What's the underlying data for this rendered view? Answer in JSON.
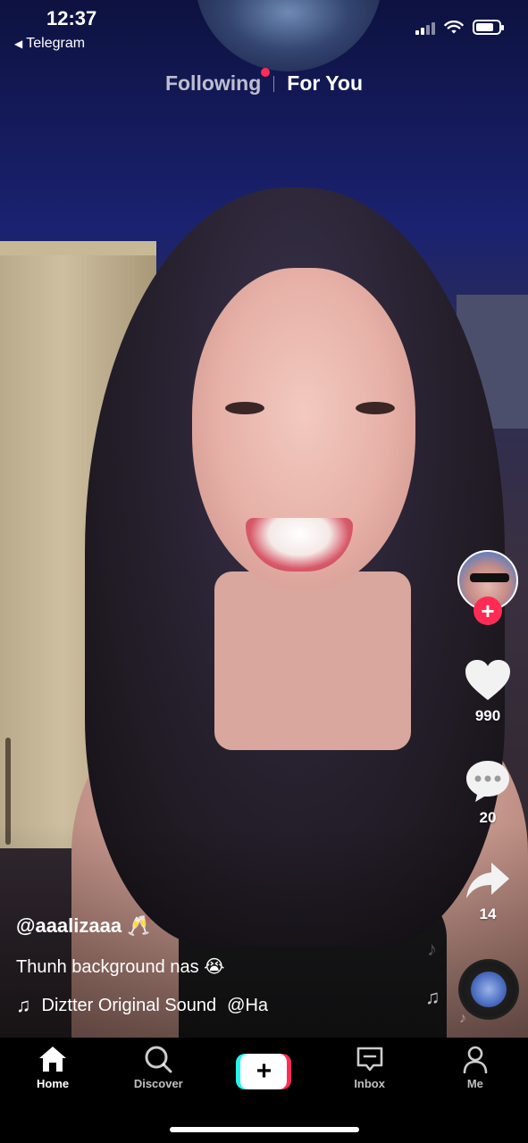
{
  "status_bar": {
    "time": "12:37",
    "back_app": "Telegram"
  },
  "top_tabs": {
    "following": "Following",
    "for_you": "For You"
  },
  "rail": {
    "likes": "990",
    "comments": "20",
    "shares": "14",
    "follow_plus": "+"
  },
  "caption": {
    "username": "@aaalizaaa 🥂",
    "description": "Thunh background nas 😭",
    "sound": "Diztter Original Sound",
    "sound_tag": "@Ha"
  },
  "nav": {
    "items": [
      {
        "label": "Home",
        "icon": "home-icon"
      },
      {
        "label": "Discover",
        "icon": "search-icon"
      },
      {
        "label": "",
        "icon": "plus-icon"
      },
      {
        "label": "Inbox",
        "icon": "inbox-icon"
      },
      {
        "label": "Me",
        "icon": "profile-icon"
      }
    ],
    "create_symbol": "+"
  },
  "colors": {
    "accent_red": "#fe2c55",
    "accent_cyan": "#25f4ee"
  }
}
